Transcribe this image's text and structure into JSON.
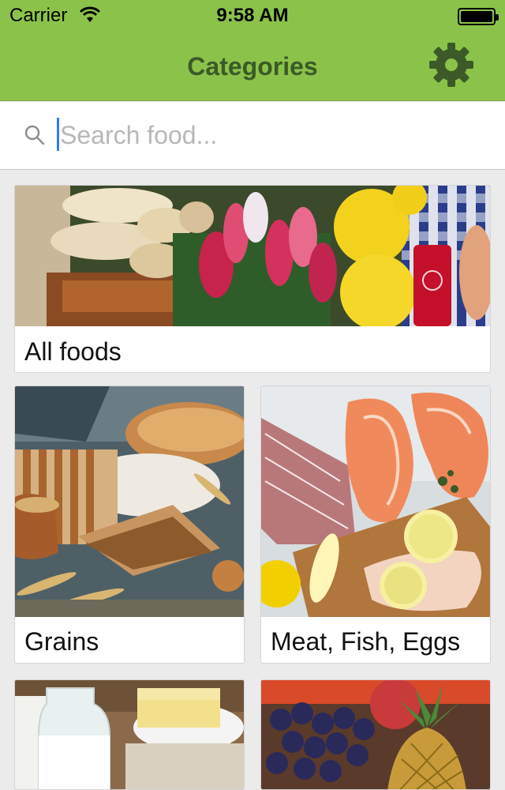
{
  "status_bar": {
    "carrier": "Carrier",
    "time": "9:58 AM",
    "wifi_icon": "wifi-icon",
    "battery_icon": "battery-icon"
  },
  "header": {
    "title": "Categories",
    "settings_icon": "gear-icon",
    "background_color": "#8bc34a",
    "title_color": "#3b5a27"
  },
  "search": {
    "placeholder": "Search food...",
    "value": "",
    "icon": "search-icon"
  },
  "categories": [
    {
      "label": "All foods",
      "image": "vegetables-lemons-bread-photo"
    },
    {
      "label": "Grains",
      "image": "bread-flour-wheat-photo"
    },
    {
      "label": "Meat, Fish, Eggs",
      "image": "salmon-meat-lemon-photo"
    },
    {
      "label": "",
      "image": "milk-butter-photo"
    },
    {
      "label": "",
      "image": "grapes-pineapple-fruit-photo"
    }
  ]
}
